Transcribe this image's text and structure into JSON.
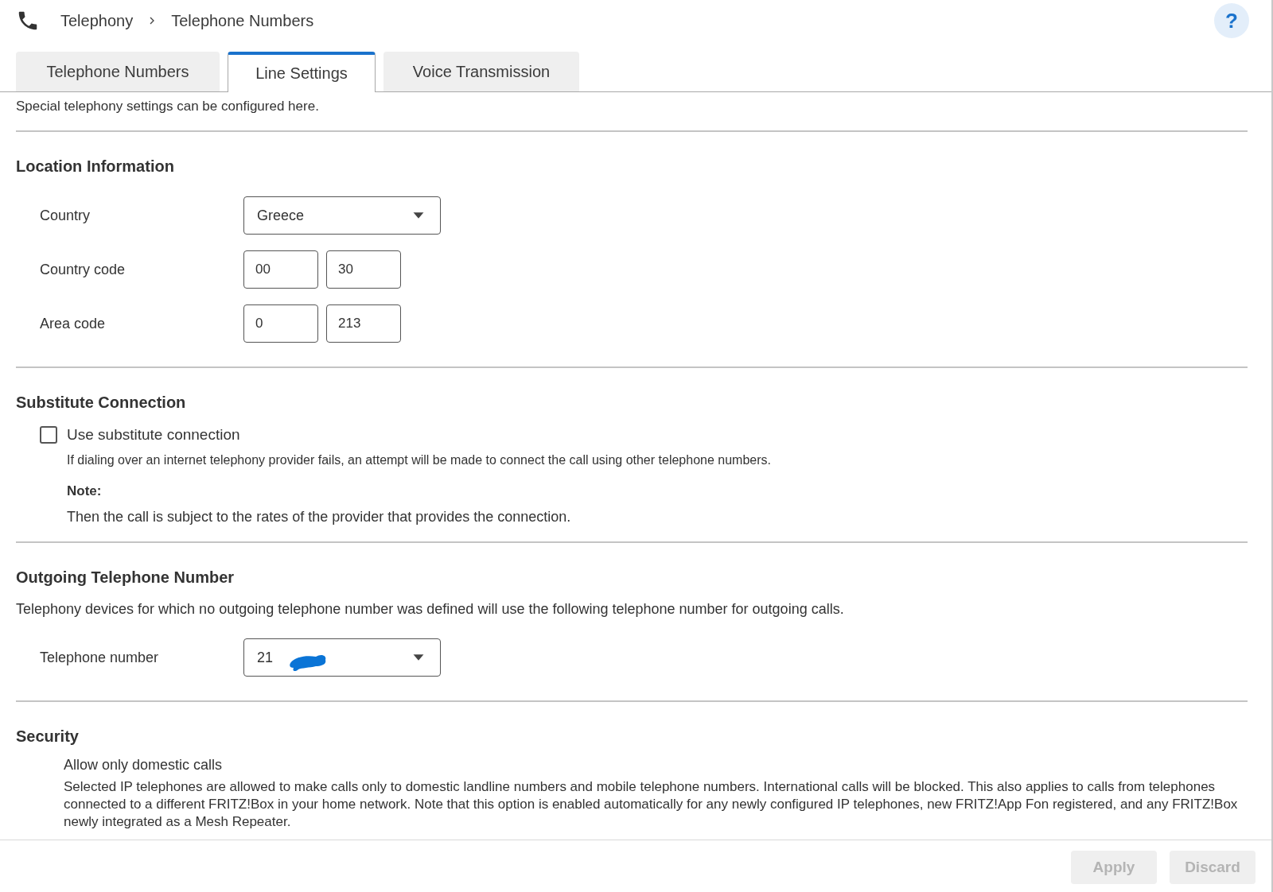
{
  "breadcrumb": [
    "Telephony",
    "Telephone Numbers"
  ],
  "help": "?",
  "tabs": [
    {
      "label": "Telephone Numbers",
      "selected": false
    },
    {
      "label": "Line Settings",
      "selected": true
    },
    {
      "label": "Voice Transmission",
      "selected": false
    }
  ],
  "intro": "Special telephony settings can be configured here.",
  "sections": [
    {
      "title": "Location Information",
      "items": [
        {
          "kind": "select",
          "label": "Country",
          "value": "Greece"
        },
        {
          "kind": "pair",
          "label": "Country code",
          "values": [
            "00",
            "30"
          ]
        },
        {
          "kind": "pair",
          "label": "Area code",
          "values": [
            "0",
            "213"
          ]
        }
      ]
    },
    {
      "title": "Substitute Connection",
      "items": [
        {
          "kind": "checkbox",
          "label": "Use substitute connection",
          "checked": false
        },
        {
          "kind": "hint",
          "text": "If dialing over an internet telephony provider fails, an attempt will be made to connect the call using other telephone numbers."
        },
        {
          "kind": "note",
          "title": "Note:",
          "text": "Then the call is subject to the rates of the provider that provides the connection."
        }
      ]
    },
    {
      "title": "Outgoing Telephone Number",
      "items": [
        {
          "kind": "text",
          "text": "Telephony devices for which no outgoing telephone number was defined will use the following telephone number for outgoing calls."
        },
        {
          "kind": "select",
          "label": "Telephone number",
          "value": "21",
          "redacted": true
        }
      ]
    },
    {
      "title": "Security",
      "items": [
        {
          "kind": "option",
          "label": "Allow only domestic calls",
          "text": "Selected IP telephones are allowed to make calls only to domestic landline numbers and mobile telephone numbers. International calls will be blocked. This also applies to calls from telephones connected to a different FRITZ!Box in your home network. Note that this option is enabled automatically for any newly configured IP telephones, new FRITZ!App Fon registered, and any FRITZ!Box newly integrated as a Mesh Repeater."
        }
      ]
    }
  ],
  "buttons": [
    {
      "label": "Apply",
      "disabled": true
    },
    {
      "label": "Discard",
      "disabled": true
    }
  ]
}
